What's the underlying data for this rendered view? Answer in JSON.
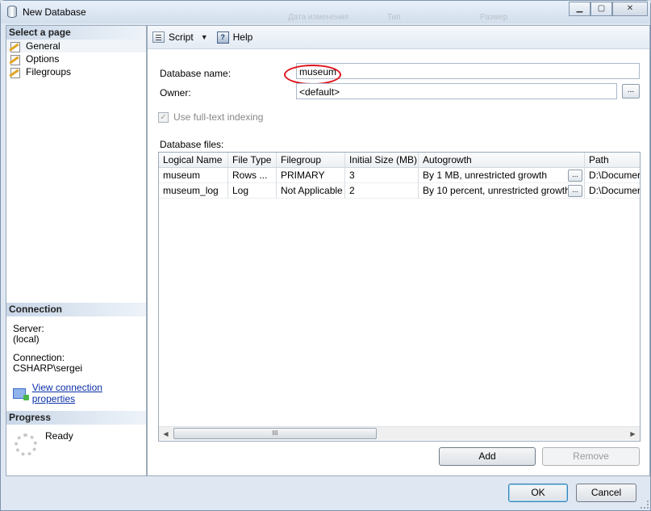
{
  "window": {
    "title": "New Database",
    "ghost_headers": [
      "Дата изменения",
      "Тип",
      "Размер"
    ],
    "buttons": {
      "minimize": "▁",
      "maximize": "▢",
      "close": "✕"
    }
  },
  "sidebar": {
    "select_page": "Select a page",
    "pages": [
      "General",
      "Options",
      "Filegroups"
    ],
    "connection": {
      "header": "Connection",
      "server_label": "Server:",
      "server_value": "(local)",
      "connection_label": "Connection:",
      "connection_value": "CSHARP\\sergei",
      "link": "View connection properties"
    },
    "progress": {
      "header": "Progress",
      "status": "Ready"
    }
  },
  "toolbar": {
    "script": "Script",
    "help": "Help"
  },
  "form": {
    "db_name_label": "Database name:",
    "db_name_value": "museum",
    "owner_label": "Owner:",
    "owner_value": "<default>",
    "owner_browse": "...",
    "fulltext_label": "Use full-text indexing",
    "fulltext_checked": true,
    "files_label": "Database files:"
  },
  "grid": {
    "columns": [
      "Logical Name",
      "File Type",
      "Filegroup",
      "Initial Size (MB)",
      "Autogrowth",
      "Path"
    ],
    "rows": [
      [
        "museum",
        "Rows ...",
        "PRIMARY",
        "3",
        "By 1 MB, unrestricted growth",
        "D:\\Documer"
      ],
      [
        "museum_log",
        "Log",
        "Not Applicable",
        "2",
        "By 10 percent, unrestricted growth",
        "D:\\Documen"
      ]
    ],
    "cell_button": "...",
    "scroll_thumb": "III"
  },
  "actions": {
    "add": "Add",
    "remove": "Remove",
    "ok": "OK",
    "cancel": "Cancel"
  },
  "colors": {
    "annotation": "#e0141c",
    "link": "#0b2fa8",
    "default_button": "#3c7fb1"
  }
}
